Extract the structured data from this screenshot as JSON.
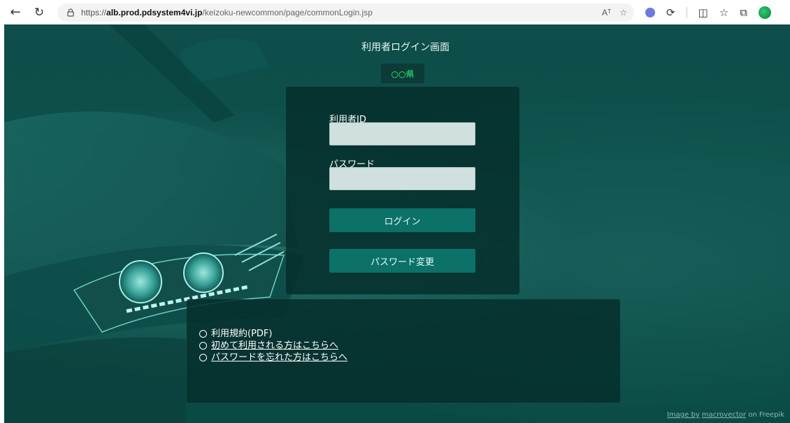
{
  "browser": {
    "url_scheme": "https://",
    "url_host": "alb.prod.pdsystem4vi.jp",
    "url_path": "/keizoku-newcommon/page/commonLogin.jsp",
    "read_aloud": "Aᵀ"
  },
  "page": {
    "title": "利用者ログイン画面",
    "prefecture": "○○県"
  },
  "login": {
    "user_id_label": "利用者ID",
    "user_id_value": "",
    "password_label": "パスワード",
    "password_value": "",
    "login_button": "ログイン",
    "change_password_button": "パスワード変更"
  },
  "links": [
    {
      "text": "利用規約(PDF)",
      "underlined": false
    },
    {
      "text": "初めて利用される方はこちらへ",
      "underlined": true
    },
    {
      "text": "パスワードを忘れた方はこちらへ",
      "underlined": true
    }
  ],
  "credit": {
    "image_by": "Image by",
    "author": "macrovector",
    "on": "on Freepik"
  },
  "colors": {
    "background": "#0c504b",
    "panel": "#06302c",
    "button": "#0b7169",
    "prefecture_text": "#2fff7a",
    "input": "#cfe0df"
  }
}
